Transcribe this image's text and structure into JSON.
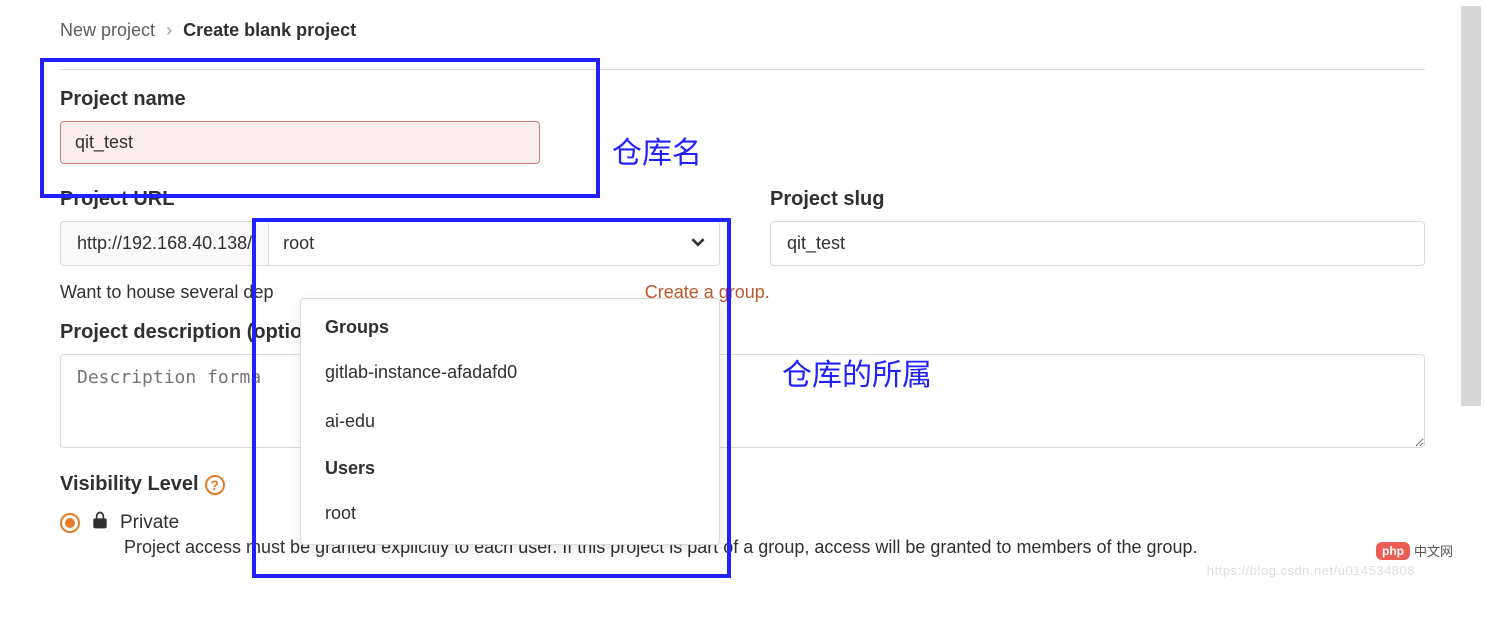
{
  "breadcrumb": {
    "parent": "New project",
    "current": "Create blank project"
  },
  "annotations": {
    "repo_name": "仓库名",
    "repo_owner": "仓库的所属"
  },
  "project_name": {
    "label": "Project name",
    "value": "qit_test"
  },
  "project_url": {
    "label": "Project URL",
    "prefix": "http://192.168.40.138/",
    "selected": "root",
    "dropdown": {
      "groups_header": "Groups",
      "groups": [
        "gitlab-instance-afadafd0",
        "ai-edu"
      ],
      "users_header": "Users",
      "users": [
        "root"
      ]
    }
  },
  "project_slug": {
    "label": "Project slug",
    "value": "qit_test"
  },
  "hint": {
    "text_prefix": "Want to house several dep",
    "link_text": "Create a group."
  },
  "description": {
    "label": "Project description (optio",
    "placeholder": "Description forma"
  },
  "visibility": {
    "label": "Visibility Level",
    "options": [
      {
        "key": "private",
        "label": "Private",
        "checked": true,
        "description": "Project access must be granted explicitly to each user. If this project is part of a group, access will be granted to members of the group."
      }
    ]
  },
  "watermark": {
    "logo": "php",
    "text": "中文网"
  },
  "faded_url": "https://blog.csdn.net/u014534808"
}
